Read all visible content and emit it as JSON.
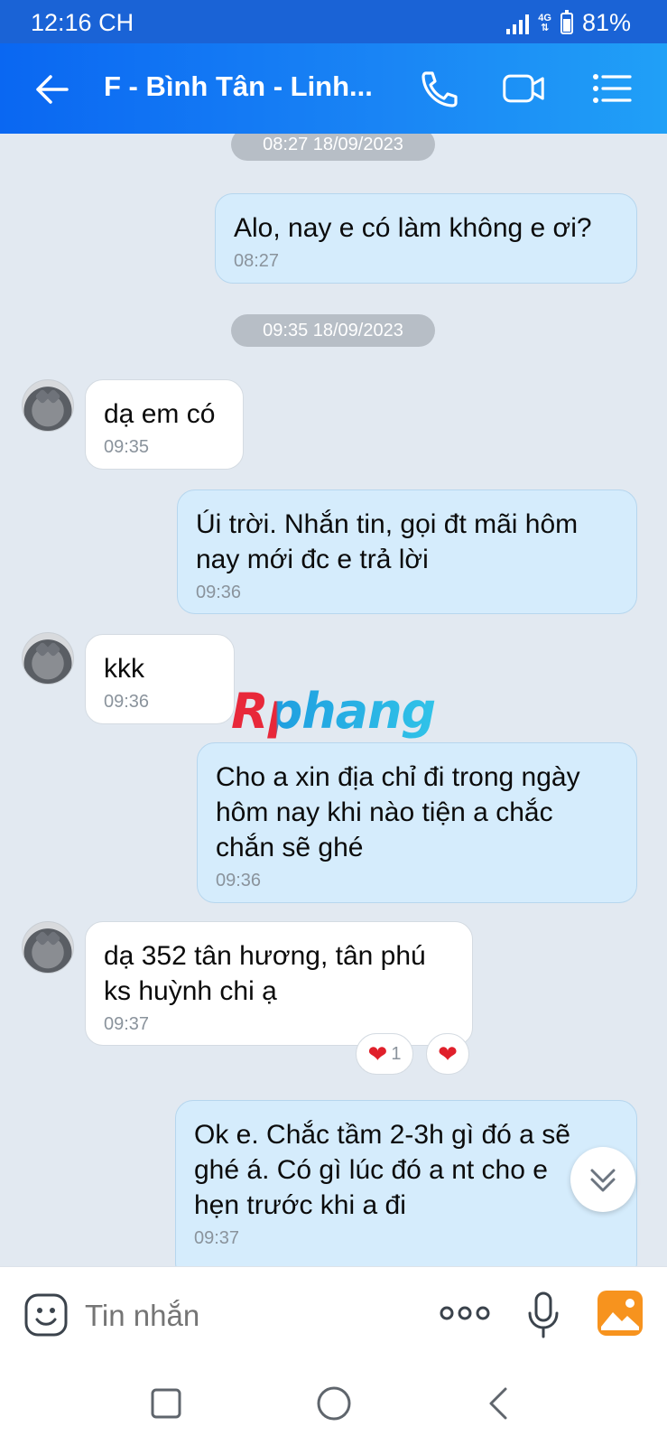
{
  "status": {
    "time": "12:16 CH",
    "network": "4G",
    "battery": "81%"
  },
  "header": {
    "title": "F - Bình Tân - Linh..."
  },
  "chat": {
    "dates": [
      "08:27 18/09/2023",
      "09:35 18/09/2023"
    ],
    "messages": [
      {
        "dir": "out",
        "text": "Alo, nay e có làm không e ơi?",
        "time": "08:27"
      },
      {
        "dir": "in",
        "text": "dạ em có",
        "time": "09:35"
      },
      {
        "dir": "out",
        "text": "Úi trời. Nhắn tin, gọi đt mãi hôm\nnay mới đc e trả lời",
        "time": "09:36"
      },
      {
        "dir": "in",
        "text": "kkk",
        "time": "09:36"
      },
      {
        "dir": "out",
        "text": "Cho a xin địa chỉ đi trong ngày\nhôm nay khi nào tiện a chắc\nchắn sẽ ghé",
        "time": "09:36"
      },
      {
        "dir": "in",
        "text": "dạ 352 tân hương, tân phú\nks huỳnh chi ạ",
        "time": "09:37"
      },
      {
        "dir": "out",
        "text": "Ok e. Chắc tầm 2-3h gì đó a sẽ\nghé á. Có gì lúc đó a nt cho e\nhẹn trước khi a đi",
        "time": "09:37"
      }
    ],
    "reaction": {
      "emoji": "❤",
      "count": "1"
    },
    "watermark": "Rphang"
  },
  "input": {
    "placeholder": "Tin nhắn"
  },
  "colors": {
    "header": "#1a7ff4",
    "outgoing": "#d5ecfc",
    "incoming": "#ffffff",
    "background": "#e2e9f1"
  }
}
